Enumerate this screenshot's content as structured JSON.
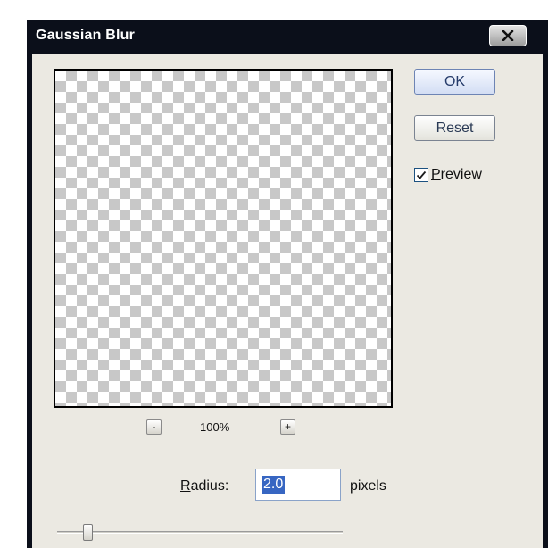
{
  "window": {
    "title": "Gaussian Blur"
  },
  "icons": {
    "close": "close-icon",
    "check": "check-icon"
  },
  "preview": {
    "zoom_out_label": "-",
    "zoom_level": "100%",
    "zoom_in_label": "+"
  },
  "buttons": {
    "ok_label": "OK",
    "reset_label": "Reset"
  },
  "preview_checkbox": {
    "mnemonic": "P",
    "label_rest": "review",
    "checked": true
  },
  "radius": {
    "label_mnemonic": "R",
    "label_rest": "adius:",
    "value": "2.0",
    "unit": "pixels"
  },
  "colors": {
    "title_bar": "#0b0f1a",
    "dialog_background": "#ebe9e2",
    "selection_highlight": "#3766c2",
    "checker_dark": "#c8c8c8",
    "checker_light": "#ffffff"
  }
}
